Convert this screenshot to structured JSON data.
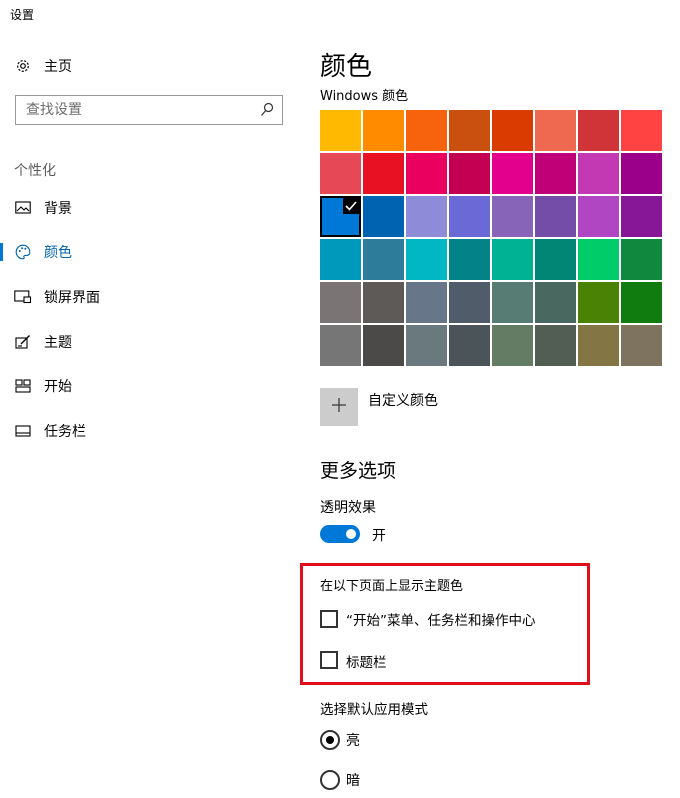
{
  "window": {
    "title": "设置"
  },
  "sidebar": {
    "home": "主页",
    "search_placeholder": "查找设置",
    "section": "个性化",
    "items": [
      {
        "label": "背景",
        "icon": "picture-icon"
      },
      {
        "label": "颜色",
        "icon": "palette-icon",
        "selected": true
      },
      {
        "label": "锁屏界面",
        "icon": "lock-screen-icon"
      },
      {
        "label": "主题",
        "icon": "theme-icon"
      },
      {
        "label": "开始",
        "icon": "start-icon"
      },
      {
        "label": "任务栏",
        "icon": "taskbar-icon"
      }
    ]
  },
  "main": {
    "title": "颜色",
    "windows_colors_label": "Windows 颜色",
    "colors": [
      [
        "#ffb900",
        "#ff8c00",
        "#f7630c",
        "#ca5010",
        "#da3b01",
        "#ef6950",
        "#d13438",
        "#ff4343"
      ],
      [
        "#e74856",
        "#e81123",
        "#ea005e",
        "#c30052",
        "#e3008c",
        "#bf0077",
        "#c239b3",
        "#9a0089"
      ],
      [
        "#0078d7",
        "#0063b1",
        "#8e8cd8",
        "#6b69d6",
        "#8764b8",
        "#744da9",
        "#b146c2",
        "#881798"
      ],
      [
        "#0099bc",
        "#2d7d9a",
        "#00b7c3",
        "#038387",
        "#00b294",
        "#018574",
        "#00cc6a",
        "#10893e"
      ],
      [
        "#7a7574",
        "#5d5a58",
        "#68768a",
        "#515c6b",
        "#567c73",
        "#486860",
        "#498205",
        "#107c10"
      ],
      [
        "#767676",
        "#4c4a48",
        "#69797e",
        "#4a5459",
        "#647c64",
        "#525e54",
        "#847545",
        "#7e735f"
      ]
    ],
    "selected_color": "#0078d7",
    "custom_color_label": "自定义颜色",
    "more_options": "更多选项",
    "transparency_label": "透明效果",
    "transparency_state": "开",
    "accent_surfaces_label": "在以下页面上显示主题色",
    "accent_start_label": "“开始”菜单、任务栏和操作中心",
    "accent_titlebar_label": "标题栏",
    "app_mode_label": "选择默认应用模式",
    "mode_light": "亮",
    "mode_dark": "暗"
  },
  "colors": {
    "accent": "#0078d7",
    "highlight": "#e0101a"
  }
}
